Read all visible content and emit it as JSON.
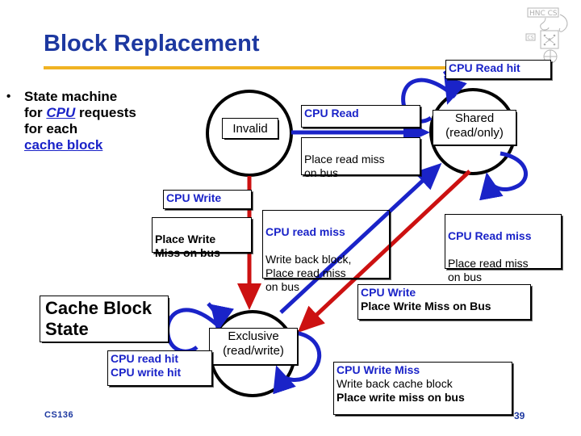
{
  "slide": {
    "title": "Block Replacement",
    "accent_color": "#f0b323",
    "title_color": "#1d38a0",
    "blue": "#1a23c8",
    "red": "#cc1111",
    "footer_course": "CS136",
    "footer_page": "39"
  },
  "bullet": {
    "marker": "•",
    "line1": "State machine",
    "line2_pre": "for ",
    "line2_kw": "CPU",
    "line2_post": " requests",
    "line3": "for each",
    "line4_kw": "cache block"
  },
  "states": [
    {
      "id": "invalid",
      "label_line1": "Invalid",
      "label_line2": ""
    },
    {
      "id": "shared",
      "label_line1": "Shared",
      "label_line2": "(read/only)"
    },
    {
      "id": "exclusive",
      "label_line1": "Exclusive",
      "label_line2": "(read/write)"
    }
  ],
  "heading_box": {
    "line1": "Cache Block",
    "line2": "State"
  },
  "labels": {
    "cpu_read_hit": {
      "blue": "CPU Read hit"
    },
    "cpu_read": {
      "blue": "CPU Read",
      "black": "Place read miss\non bus"
    },
    "cpu_write_invalid": {
      "blue": "CPU Write",
      "black_bold": "Place Write\nMiss on bus"
    },
    "cpu_read_miss": {
      "blue": "CPU read miss",
      "black": "Write back block,\nPlace read miss\non bus"
    },
    "cpu_read_miss_right": {
      "blue": "CPU Read miss",
      "black": "Place read miss\non bus"
    },
    "cpu_write_shared": {
      "blue": "CPU Write",
      "black_bold": "Place Write Miss on Bus"
    },
    "cpu_hits": {
      "blue_line1": "CPU read hit",
      "blue_line2": "CPU write hit"
    },
    "cpu_write_miss": {
      "blue": "CPU Write Miss",
      "black": "Write back cache block",
      "black_bold": "Place write miss on bus"
    }
  }
}
